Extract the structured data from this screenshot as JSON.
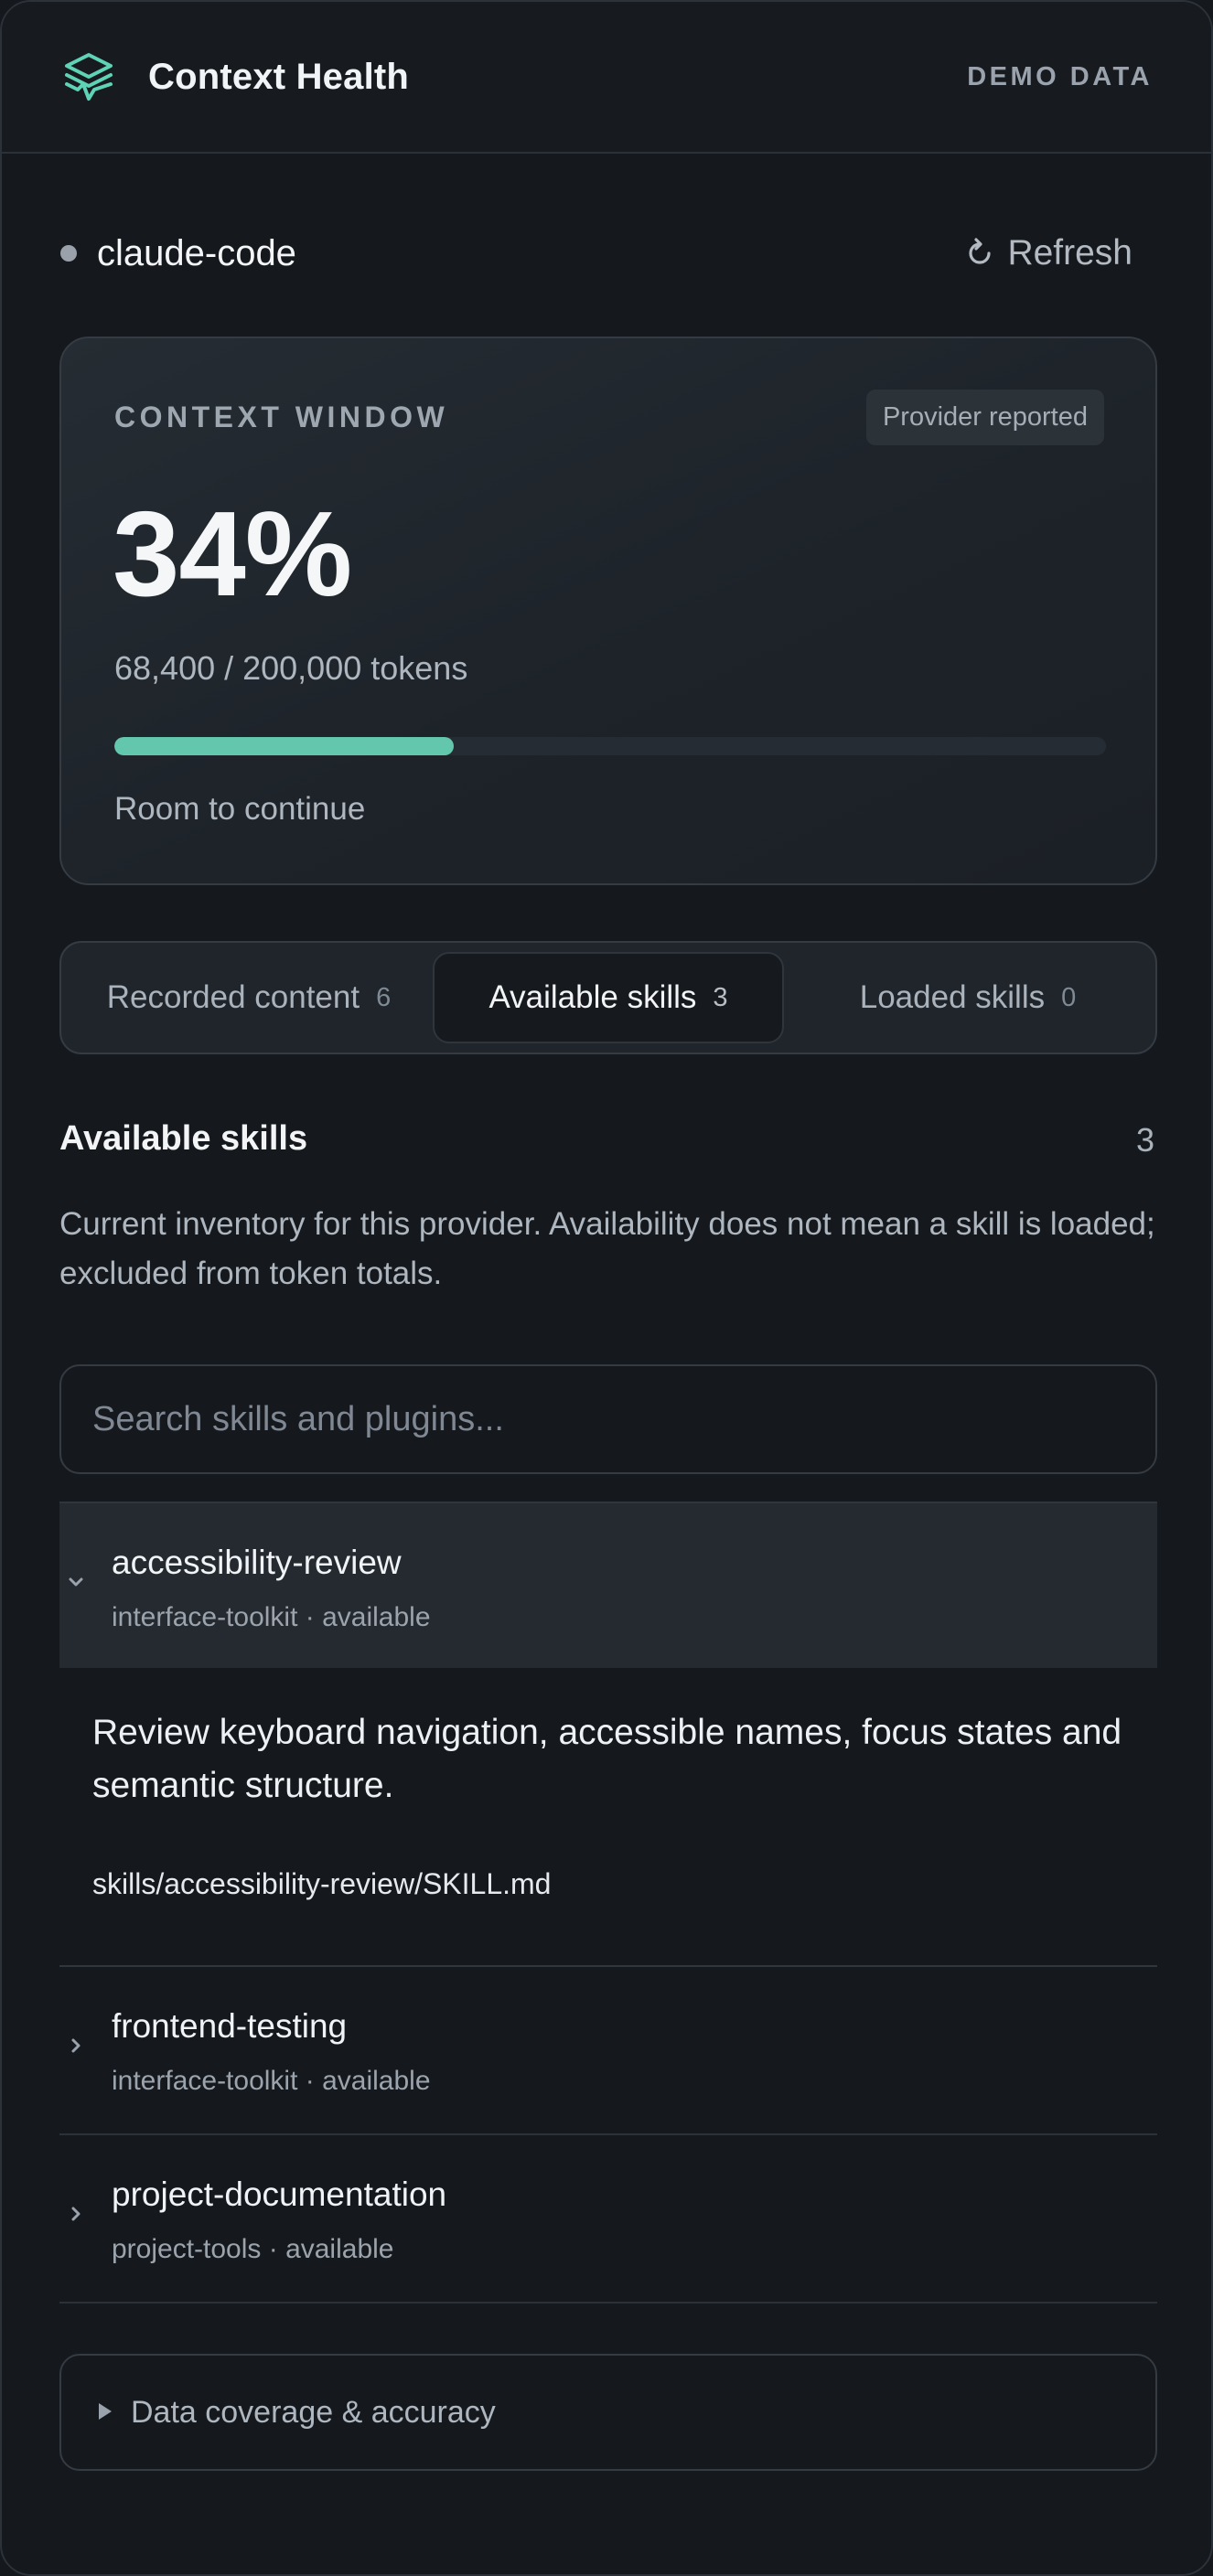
{
  "header": {
    "title": "Context Health",
    "badge": "DEMO DATA",
    "accent_color": "#5fd3b6",
    "logo_icon": "layers-pulse-icon"
  },
  "provider": {
    "name": "claude-code",
    "status_icon": "status-dot",
    "refresh_label": "Refresh",
    "refresh_icon": "refresh-icon"
  },
  "context_window": {
    "label": "CONTEXT WINDOW",
    "source_badge": "Provider reported",
    "percent": "34%",
    "tokens": "68,400 / 200,000 tokens",
    "progress_fraction": 0.342,
    "progress_color": "#63c7ae",
    "status": "Room to continue"
  },
  "tabs": [
    {
      "label": "Recorded content",
      "count": "6",
      "active": false
    },
    {
      "label": "Available skills",
      "count": "3",
      "active": true
    },
    {
      "label": "Loaded skills",
      "count": "0",
      "active": false
    }
  ],
  "section": {
    "title": "Available skills",
    "count": "3",
    "description": "Current inventory for this provider. Availability does not mean a skill is loaded; excluded from token totals."
  },
  "search": {
    "placeholder": "Search skills and plugins...",
    "value": ""
  },
  "skills": [
    {
      "name": "accessibility-review",
      "meta": "interface-toolkit · available",
      "expanded": true,
      "icon": "chevron-down-icon",
      "description": "Review keyboard navigation, accessible names, focus states and semantic structure.",
      "path": "skills/accessibility-review/SKILL.md"
    },
    {
      "name": "frontend-testing",
      "meta": "interface-toolkit · available",
      "expanded": false,
      "icon": "chevron-right-icon"
    },
    {
      "name": "project-documentation",
      "meta": "project-tools · available",
      "expanded": false,
      "icon": "chevron-right-icon"
    }
  ],
  "coverage": {
    "label": "Data coverage & accuracy",
    "icon": "disclosure-triangle-icon"
  }
}
